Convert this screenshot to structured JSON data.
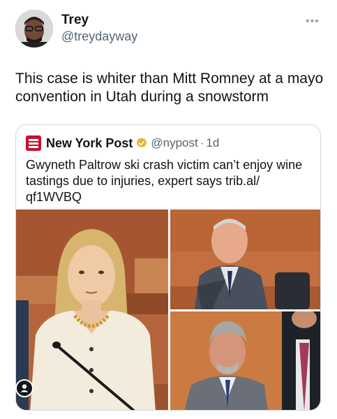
{
  "tweet": {
    "author_name": "Trey",
    "author_handle": "@treydayway",
    "more_icon": "more-horizontal-icon",
    "text": "This case is whiter than Mitt Romney at a mayo convention in Utah during a snowstorm"
  },
  "quote": {
    "source_name": "New York Post",
    "source_handle": "@nypost",
    "separator": "·",
    "time": "1d",
    "logo_icon": "new-york-post-logo",
    "verified_icon": "verified-gold-badge-icon",
    "verified_color": "#e8b32c",
    "text": "Gwyneth Paltrow ski crash victim can’t enjoy wine tastings due to injuries, expert says trib.al/ qf1WVBQ",
    "media": [
      {
        "description_icon": "photo-woman-courtroom"
      },
      {
        "description_icon": "photo-older-man-courtroom"
      },
      {
        "description_icon": "photo-man-gray-hair-courtroom"
      }
    ]
  },
  "colors": {
    "text": "#0f1419",
    "secondary_text": "#536471",
    "border": "#cfd9de",
    "nypost_red": "#c8102e"
  }
}
